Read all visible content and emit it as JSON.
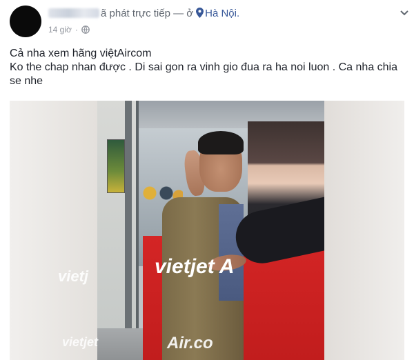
{
  "post": {
    "author_suffix": "ã phát trực tiếp — ở",
    "location": "Hà Nội.",
    "timestamp": "14 giờ",
    "dot": "·",
    "privacy_icon": "globe-icon",
    "menu_icon": "chevron-down-icon",
    "text_lines": [
      "Cả nha xem hãng việtAircom",
      "Ko the chap nhan được . Di sai gon ra vinh gio đua ra ha noi luon . Ca nha chia se nhe"
    ]
  },
  "video": {
    "banner_texts": [
      "vietj",
      "vietjet A",
      "vietjet",
      "Air.co"
    ]
  },
  "colors": {
    "location_link": "#385898",
    "meta_gray": "#90949c",
    "banner_red": "#d42525"
  }
}
